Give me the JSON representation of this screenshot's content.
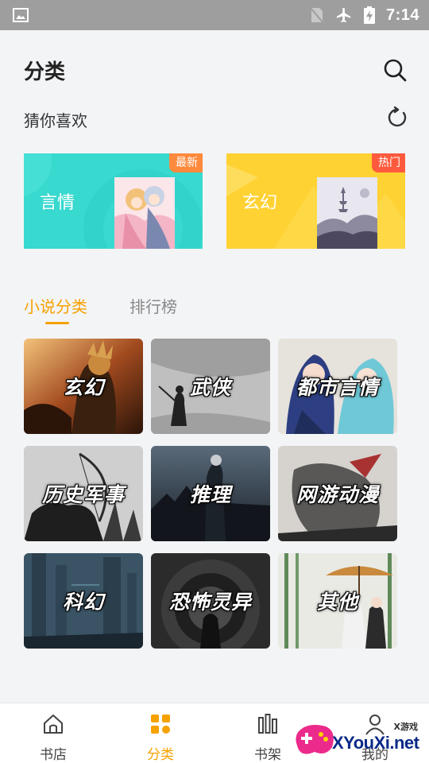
{
  "status_bar": {
    "time": "7:14"
  },
  "header": {
    "title": "分类"
  },
  "recommend": {
    "title": "猜你喜欢",
    "cards": [
      {
        "label": "言情",
        "badge": "最新",
        "color": "#38d9cf"
      },
      {
        "label": "玄幻",
        "badge": "热门",
        "color": "#ffd233"
      }
    ]
  },
  "tabs": [
    {
      "label": "小说分类",
      "active": true
    },
    {
      "label": "排行榜",
      "active": false
    }
  ],
  "categories": [
    {
      "label": "玄幻"
    },
    {
      "label": "武侠"
    },
    {
      "label": "都市言情"
    },
    {
      "label": "历史军事"
    },
    {
      "label": "推理"
    },
    {
      "label": "网游动漫"
    },
    {
      "label": "科幻"
    },
    {
      "label": "恐怖灵异"
    },
    {
      "label": "其他"
    }
  ],
  "bottom_nav": [
    {
      "label": "书店",
      "icon": "home-icon"
    },
    {
      "label": "分类",
      "icon": "category-icon",
      "active": true
    },
    {
      "label": "书架",
      "icon": "bookshelf-icon"
    },
    {
      "label": "我的",
      "icon": "profile-icon"
    }
  ],
  "watermark": {
    "small": "X游戏",
    "text": "XYouXi.net"
  },
  "colors": {
    "accent": "#f5a100",
    "card_teal": "#38d9cf",
    "card_yellow": "#ffd233"
  }
}
